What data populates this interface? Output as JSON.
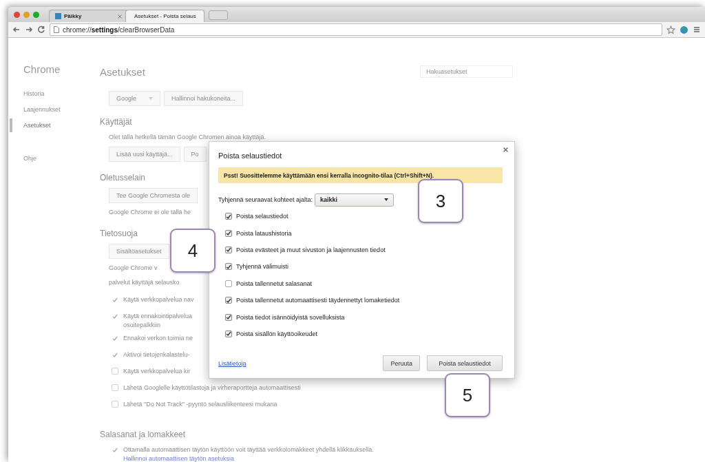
{
  "window": {
    "controls": [
      {
        "color": "#e0443e"
      },
      {
        "color": "#dea123"
      },
      {
        "color": "#1aab29"
      }
    ]
  },
  "tabs": [
    {
      "title": "Päikky",
      "selected": false
    },
    {
      "title": "Asetukset - Poista selaus",
      "selected": true
    }
  ],
  "address_bar": {
    "url": "chrome://**settings**/clearBrowserData"
  },
  "sidebar": {
    "title": "Chrome",
    "items": [
      {
        "label": "Historia",
        "selected": false
      },
      {
        "label": "Laajennukset",
        "selected": false
      },
      {
        "label": "Asetukset",
        "selected": true
      },
      {
        "label": "Ohje",
        "selected": false
      }
    ]
  },
  "settings": {
    "title": "Asetukset",
    "search": {
      "placeholder": "Hakuasetukset"
    },
    "rows": [
      {
        "kind": "controls",
        "controls": [
          {
            "kind": "select",
            "label": "Google"
          },
          {
            "kind": "button",
            "label": "Hallinnoi hakukoneita..."
          }
        ]
      },
      {
        "kind": "heading",
        "text": "Käyttäjät"
      },
      {
        "kind": "text",
        "text": "Olet tällä hetkellä tämän Google Chromen ainoa käyttäjä."
      },
      {
        "kind": "controls",
        "controls": [
          {
            "kind": "button",
            "label": "Lisää uusi käyttäjä..."
          },
          {
            "kind": "button",
            "label": "Po"
          }
        ]
      },
      {
        "kind": "heading",
        "text": "Oletusselain"
      },
      {
        "kind": "controls",
        "controls": [
          {
            "kind": "button",
            "label": "Tee Google Chromesta ole"
          }
        ]
      },
      {
        "kind": "text",
        "text": "Google Chrome ei ole tällä he"
      },
      {
        "kind": "heading",
        "text": "Tietosuoja"
      },
      {
        "kind": "controls",
        "controls": [
          {
            "kind": "button",
            "label": "Sisältöasetukset"
          }
        ]
      },
      {
        "kind": "text",
        "text": "Google Chrome v"
      },
      {
        "kind": "text",
        "text": "palvelut käyttäjä selausko"
      },
      {
        "kind": "checkbox",
        "lines": [
          "Käytä verkkopalvelua nav"
        ],
        "checked": true
      },
      {
        "kind": "checkbox",
        "lines": [
          "Käytä ennakointipalvelua",
          "osoitepalkkiin"
        ],
        "checked": true
      },
      {
        "kind": "checkbox",
        "lines": [
          "Ennakoi verkon toimia ne"
        ],
        "checked": true
      },
      {
        "kind": "checkbox",
        "lines": [
          "Aktivoi tietojenkalastelu-"
        ],
        "checked": true
      },
      {
        "kind": "checkbox",
        "lines": [
          "Käytä verkkopalvelua kir"
        ],
        "checked": false
      },
      {
        "kind": "checkbox",
        "lines": [
          "Lähetä Googlelle käyttötilastoja ja virheraportteja automaattisesti"
        ],
        "checked": false
      },
      {
        "kind": "checkbox",
        "lines": [
          "Lähetä \"Do Not Track\" -pyyntö selausliikenteesi mukana"
        ],
        "checked": false
      },
      {
        "kind": "heading",
        "text": "Salasanat ja lomakkeet"
      },
      {
        "kind": "checkbox",
        "lines": [
          "Ottamalla automaattisen täytön käyttöön voit täyttää verkkolomakkeet yhdellä klikkauksella."
        ],
        "checked": true
      },
      {
        "kind": "link",
        "text": "Hallinnoi automaattisen täytön asetuksia"
      }
    ]
  },
  "dialog": {
    "title": "Poista selaustiedot",
    "banner": "Psst! Suosittelemme käyttämään ensi kerralla incognito-tilaa (Ctrl+Shift+N).",
    "range_label": "Tyhjennä seuraavat kohteet ajalta:",
    "range_value": "kaikki",
    "options": [
      {
        "label": "Poista selaustiedot",
        "checked": true
      },
      {
        "label": "Poista lataushistoria",
        "checked": true
      },
      {
        "label": "Poista evästeet ja muut sivuston ja laajennusten tiedot",
        "checked": true
      },
      {
        "label": "Tyhjennä välimuisti",
        "checked": true
      },
      {
        "label": "Poista tallennetut salasanat",
        "checked": false
      },
      {
        "label": "Poista tallennetut automaattisesti täydennettyt lomaketiedot",
        "checked": true
      },
      {
        "label": "Poista tiedot isännöidyistä sovelluksista",
        "checked": true
      },
      {
        "label": "Poista sisällön käyttöoikeudet",
        "checked": true
      }
    ],
    "link": "Lisätietoja",
    "buttons": [
      "Peruuta",
      "Poista selaustiedot"
    ]
  },
  "callouts": [
    "3",
    "4",
    "5"
  ]
}
